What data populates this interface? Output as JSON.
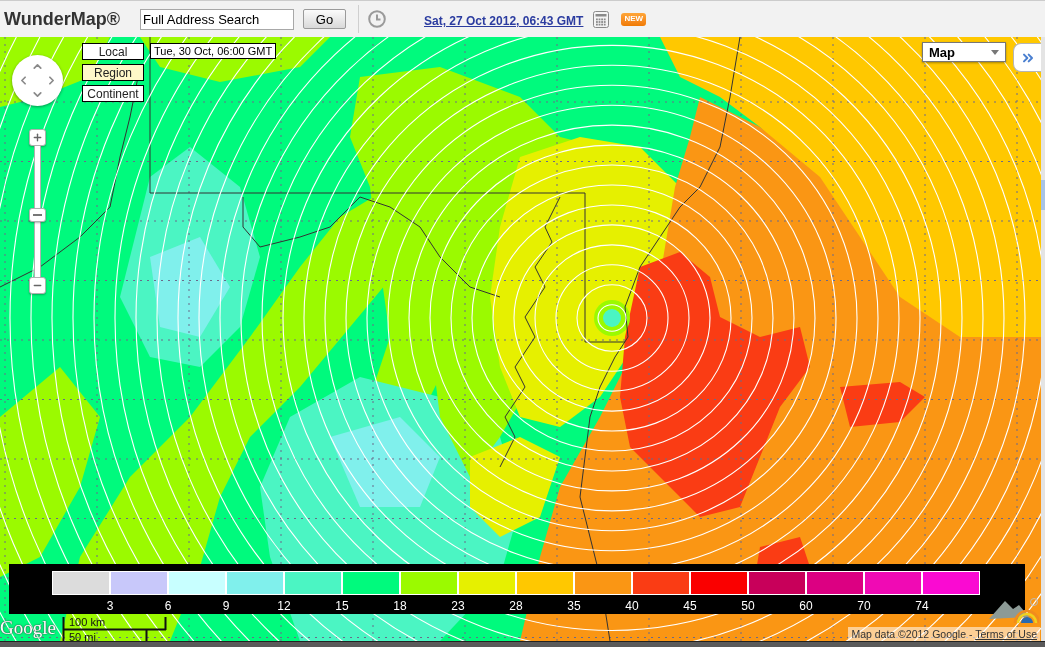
{
  "header": {
    "title": "WunderMap®",
    "search": {
      "value": "Full Address Search"
    },
    "go_button": "Go",
    "date_link": "Sat, 27 Oct 2012, 06:43 GMT",
    "badge": "NEW"
  },
  "map": {
    "view_buttons": [
      {
        "label": "Local",
        "selected": false
      },
      {
        "label": "Region",
        "selected": true
      },
      {
        "label": "Continent",
        "selected": false
      }
    ],
    "forecast_time": "Tue, 30 Oct, 06:00 GMT",
    "zoom": {
      "level": 0.47
    },
    "map_type": {
      "value": "Map"
    },
    "legend": [
      {
        "color": "#dcdcdc",
        "label": "3"
      },
      {
        "color": "#c8c8fa",
        "label": "6"
      },
      {
        "color": "#c8ffff",
        "label": "9"
      },
      {
        "color": "#80f0ec",
        "label": "12"
      },
      {
        "color": "#4bf5c3",
        "label": "15"
      },
      {
        "color": "#00fa7d",
        "label": "18"
      },
      {
        "color": "#9bfa00",
        "label": "23"
      },
      {
        "color": "#e6f000",
        "label": "28"
      },
      {
        "color": "#ffc800",
        "label": "35"
      },
      {
        "color": "#fa9614",
        "label": "40"
      },
      {
        "color": "#fa3c14",
        "label": "45"
      },
      {
        "color": "#fa0000",
        "label": "50"
      },
      {
        "color": "#c8005a",
        "label": "60"
      },
      {
        "color": "#dc0082",
        "label": "70"
      },
      {
        "color": "#f00ab4",
        "label": "74"
      },
      {
        "color": "#fa0ad2"
      }
    ],
    "logo": "Google",
    "scale": {
      "metric": "100 km",
      "imperial": "50 mi"
    },
    "attribution": {
      "text": "Map data ©2012 Google -",
      "link": "Terms of Use"
    }
  }
}
